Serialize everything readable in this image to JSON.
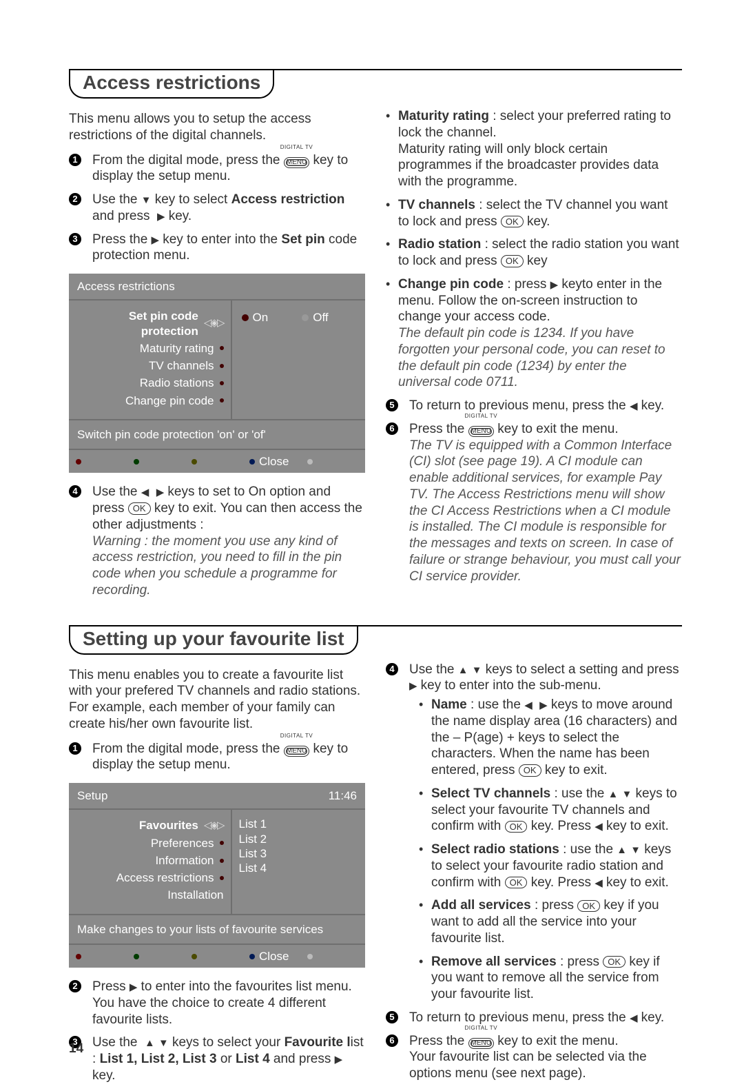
{
  "section1": {
    "title": "Access restrictions",
    "intro": "This menu allows you to setup the access restrictions of the digital channels.",
    "steps_left": {
      "s1a": "From the digital mode, press the ",
      "s1b": " key to display the setup menu.",
      "s2a": "Use the ",
      "s2b": " key to select ",
      "s2c": "Access restriction",
      "s2d": " and press ",
      "s2e": " key.",
      "s3a": "Press the ",
      "s3b": " key to enter into the ",
      "s3c": "Set pin",
      "s3d": " code protection menu.",
      "s4a": "Use the ",
      "s4b": " keys to set to On option and press ",
      "s4c": " key to exit. You can then access the other adjustments :",
      "s4note": "Warning : the moment you use any kind of access restriction, you need to fill in the pin code when you schedule a programme for recording."
    },
    "right": {
      "maturity_h": "Maturity rating",
      "maturity1": " : select your preferred rating to lock the channel.",
      "maturity2": "Maturity rating will only block certain programmes if the broadcaster provides data with the programme.",
      "tvh": "TV channels",
      "tv1": " : select the TV channel you want to lock and press ",
      "tv2": " key.",
      "rah": "Radio station",
      "ra1": " : select the radio station you want to lock and press ",
      "ra2": " key",
      "cph": "Change pin code",
      "cp1": " : press ",
      "cp2": " keyto enter in the menu. Follow the on-screen instruction to change your access code.",
      "cpn": "The default pin code is 1234. If you have forgotten your personal code, you can reset to the default pin code (1234) by enter the universal code 0711.",
      "s5a": "To return to previous menu, press the ",
      "s5b": " key.",
      "s6a": "Press the ",
      "s6b": " key to exit the menu.",
      "s6n": "The TV is equipped with a Common Interface (CI) slot (see page 19). A CI module can enable additional services, for example Pay TV. The Access Restrictions menu will show the CI Access Restrictions when a CI module is installed. The CI module is responsible for the messages and texts on screen. In case of failure or strange behaviour, you must call your CI service provider."
    },
    "menu": {
      "title": "Access restrictions",
      "rows": [
        "Set pin code protection",
        "Maturity rating",
        "TV channels",
        "Radio stations",
        "Change pin code"
      ],
      "on": "On",
      "off": "Off",
      "hint": "Switch pin code protection 'on' or 'of'",
      "close": "Close"
    }
  },
  "section2": {
    "title": "Setting up your favourite list",
    "intro": "This menu enables you to create a favourite list with your prefered TV channels and radio stations. For example, each member of your family can create his/her own favourite list.",
    "steps_left": {
      "s1a": "From the digital mode, press the ",
      "s1b": " key to display the setup menu.",
      "s2a": "Press ",
      "s2b": " to enter into the favourites list menu. You have the choice to create 4 different favourite lists.",
      "s3a": "Use the ",
      "s3b": " keys to select your ",
      "s3c": "Favourite l",
      "s3d": "ist : ",
      "s3e": "List 1, List 2, List 3",
      "s3f": " or ",
      "s3g": "List 4",
      "s3h": " and press ",
      "s3i": " key."
    },
    "right": {
      "s4a": "Use the ",
      "s4b": " keys to select a setting and press ",
      "s4c": " key to enter into the sub-menu.",
      "nameh": "Name",
      "name1": " : use the ",
      "name2": " keys to move around the name display area (16 characters) and the – P(age) + keys to select the characters. When the name has been entered, press ",
      "name3": " key to exit.",
      "stvh": "Select TV channels",
      "stv1": " : use the ",
      "stv2": " keys to select your favourite TV channels and confirm with ",
      "stv3": " key. Press ",
      "stv4": " key to exit.",
      "srh": "Select radio stations",
      "sr1": " : use the ",
      "sr2": " keys to select your favourite radio station and confirm with ",
      "sr3": " key. Press ",
      "sr4": " key to exit.",
      "aah": "Add all services",
      "aa1": " : press ",
      "aa2": " key if you want to add all the service into your favourite list.",
      "rah": "Remove all services",
      "ra1": " : press ",
      "ra2": " key if you want to remove all the service from your favourite list.",
      "s5a": "To return to previous menu, press the ",
      "s5b": " key.",
      "s6a": "Press the ",
      "s6b": " key to exit the menu.",
      "s6c": "Your favourite list can be selected via the options menu (see next page)."
    },
    "menu": {
      "title": "Setup",
      "time": "11:46",
      "rows": [
        "Favourites",
        "Preferences",
        "Information",
        "Access restrictions",
        "Installation"
      ],
      "lists": [
        "List 1",
        "List 2",
        "List 3",
        "List 4"
      ],
      "hint": "Make changes to your lists of favourite services",
      "close": "Close"
    }
  },
  "keys": {
    "menu_top": "DIGITAL TV",
    "menu": "MENU",
    "ok": "OK",
    "right": "▶",
    "left": "◀",
    "up": "▲",
    "down": "▼"
  },
  "pagenum": "14"
}
